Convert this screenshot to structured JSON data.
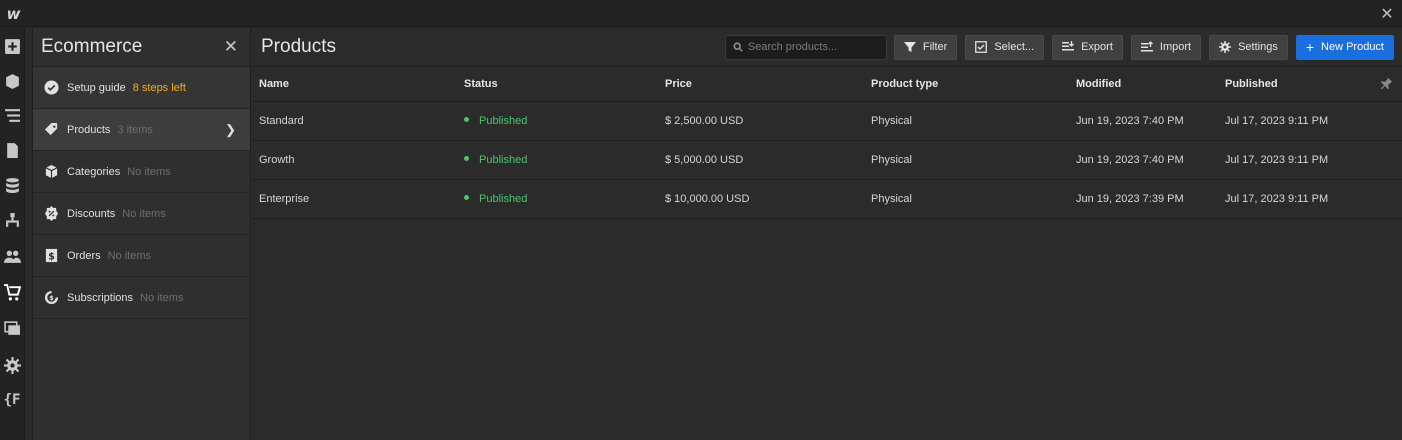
{
  "app": {
    "logo": "w"
  },
  "panel": {
    "title": "Ecommerce",
    "items": [
      {
        "label": "Setup guide",
        "sub": "8 steps left",
        "icon": "check-circle-icon"
      },
      {
        "label": "Products",
        "sub": "3 items",
        "icon": "tag-icon"
      },
      {
        "label": "Categories",
        "sub": "No items",
        "icon": "box-icon"
      },
      {
        "label": "Discounts",
        "sub": "No items",
        "icon": "discount-badge-icon"
      },
      {
        "label": "Orders",
        "sub": "No items",
        "icon": "receipt-icon"
      },
      {
        "label": "Subscriptions",
        "sub": "No items",
        "icon": "subscription-icon"
      }
    ]
  },
  "main": {
    "title": "Products",
    "search_placeholder": "Search products...",
    "toolbar": {
      "filter": "Filter",
      "select": "Select...",
      "export": "Export",
      "import": "Import",
      "settings": "Settings",
      "new_product": "New Product"
    },
    "columns": [
      "Name",
      "Status",
      "Price",
      "Product type",
      "Modified",
      "Published"
    ],
    "rows": [
      {
        "name": "Standard",
        "status": "Published",
        "price": "$ 2,500.00 USD",
        "type": "Physical",
        "modified": "Jun 19, 2023 7:40 PM",
        "published": "Jul 17, 2023 9:11 PM"
      },
      {
        "name": "Growth",
        "status": "Published",
        "price": "$ 5,000.00 USD",
        "type": "Physical",
        "modified": "Jun 19, 2023 7:40 PM",
        "published": "Jul 17, 2023 9:11 PM"
      },
      {
        "name": "Enterprise",
        "status": "Published",
        "price": "$ 10,000.00 USD",
        "type": "Physical",
        "modified": "Jun 19, 2023 7:39 PM",
        "published": "Jul 17, 2023 9:11 PM"
      }
    ]
  },
  "colors": {
    "accent": "#1a6fe0",
    "published": "#4cc56c",
    "setup_badge": "#f2ac1e"
  }
}
